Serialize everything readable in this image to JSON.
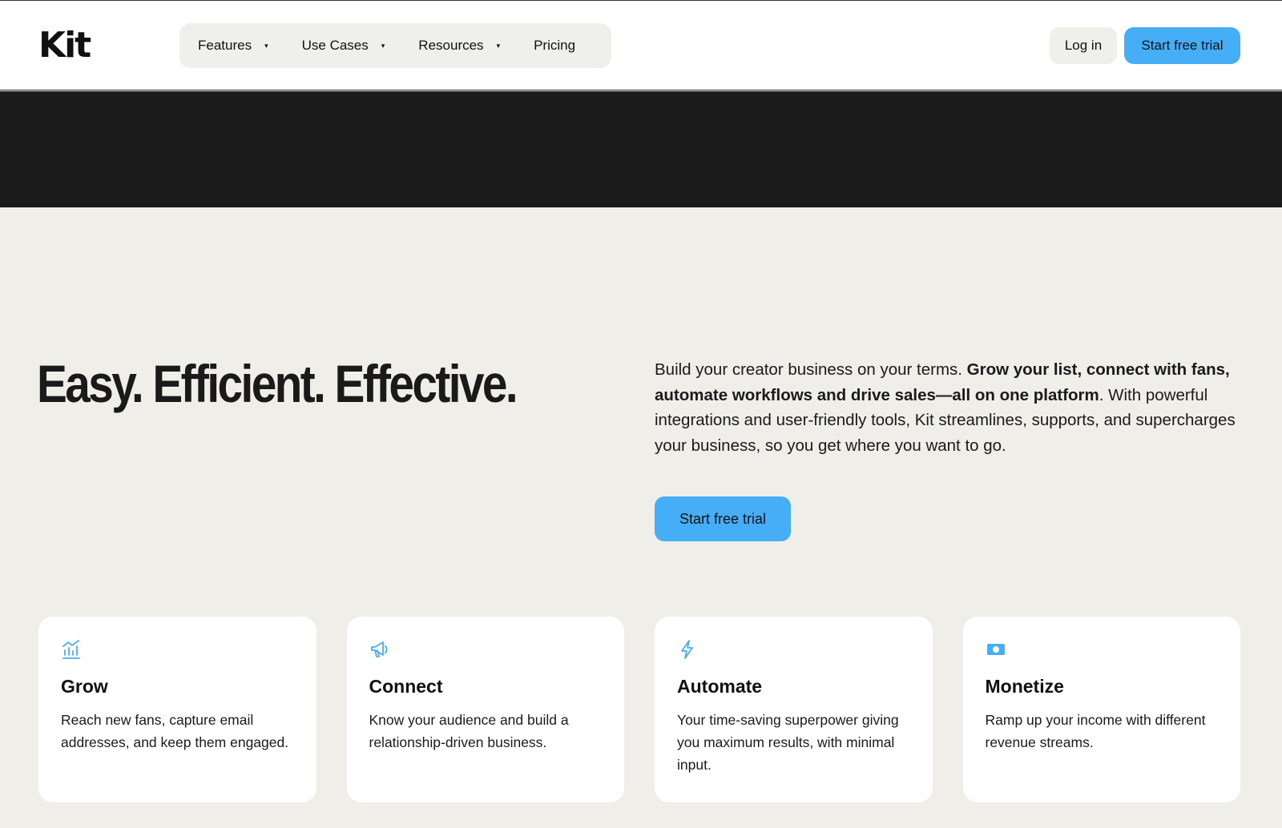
{
  "header": {
    "logo": "Kit",
    "nav": [
      {
        "label": "Features",
        "has_caret": true
      },
      {
        "label": "Use Cases",
        "has_caret": true
      },
      {
        "label": "Resources",
        "has_caret": true
      },
      {
        "label": "Pricing",
        "has_caret": false
      }
    ],
    "caret_glyph": "▾",
    "login_label": "Log in",
    "trial_label": "Start free trial"
  },
  "hero": {
    "title": "Easy. Efficient. Effective.",
    "text_intro": "Build your creator business on your terms. ",
    "text_bold": "Grow your list, connect with fans, automate workflows and drive sales—all on one platform",
    "text_rest": ". With powerful integrations and user-friendly tools, Kit streamlines, supports, and supercharges your business, so you get where you want to go.",
    "cta_label": "Start free trial"
  },
  "cards": [
    {
      "icon": "chart-icon",
      "title": "Grow",
      "text": "Reach new fans, capture email addresses, and keep them engaged."
    },
    {
      "icon": "megaphone-icon",
      "title": "Connect",
      "text": "Know your audience and build a relationship-driven business."
    },
    {
      "icon": "lightning-icon",
      "title": "Automate",
      "text": "Your time-saving superpower giving you maximum results, with minimal input."
    },
    {
      "icon": "money-icon",
      "title": "Monetize",
      "text": "Ramp up your income with different revenue streams."
    }
  ],
  "colors": {
    "accent": "#46aef7",
    "dark_band": "#1c1c1c",
    "page_bg": "#efeee9"
  }
}
